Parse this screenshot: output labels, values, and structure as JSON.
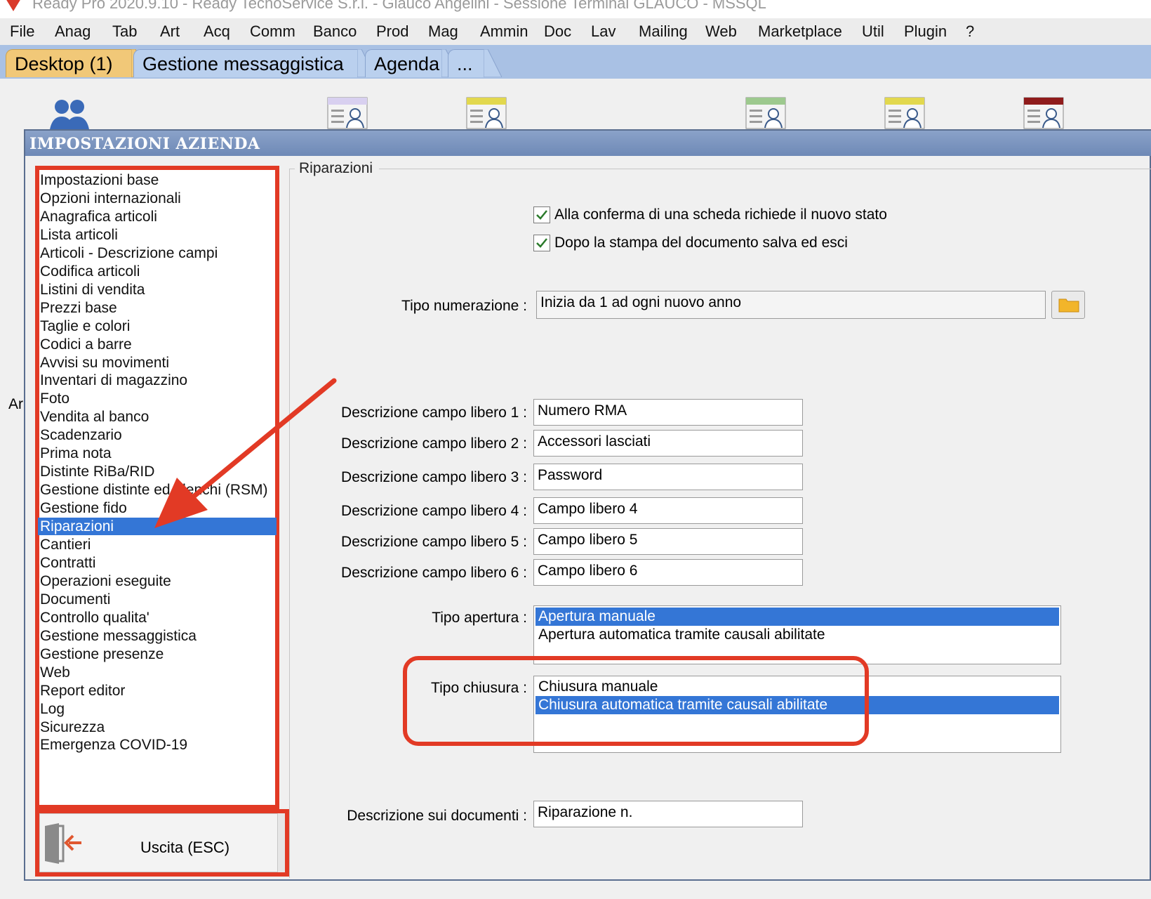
{
  "window": {
    "title": "Ready Pro 2020.9.10 - Ready TecnoService S.r.l. - Glauco Angelini - Sessione Terminal GLAUCO - MSSQL"
  },
  "menu": [
    "File",
    "Anag",
    "Tab",
    "Art",
    "Acq",
    "Comm",
    "Banco",
    "Prod",
    "Mag",
    "Ammin",
    "Doc",
    "Lav",
    "Mailing",
    "Web",
    "Marketplace",
    "Util",
    "Plugin",
    "?"
  ],
  "tabs": [
    {
      "label": "Desktop (1)",
      "active": true
    },
    {
      "label": "Gestione messaggistica",
      "active": false
    },
    {
      "label": "Agenda",
      "active": false
    },
    {
      "label": "...",
      "active": false
    }
  ],
  "desktop": {
    "partial_label": "Ar",
    "icon_colors": [
      "#d8d0f0",
      "#e2d84e",
      "#9dc98e",
      "#e2d84e",
      "#8f1c1c"
    ]
  },
  "dialog": {
    "title": "IMPOSTAZIONI AZIENDA",
    "nav_items": [
      "Impostazioni base",
      "Opzioni internazionali",
      "Anagrafica articoli",
      "Lista articoli",
      "Articoli - Descrizione campi",
      "Codifica articoli",
      "Listini di vendita",
      "Prezzi base",
      "Taglie e colori",
      "Codici a barre",
      "Avvisi su movimenti",
      "Inventari di magazzino",
      "Foto",
      "Vendita al banco",
      "Scadenzario",
      "Prima nota",
      "Distinte RiBa/RID",
      "Gestione distinte ed elenchi (RSM)",
      "Gestione fido",
      "Riparazioni",
      "Cantieri",
      "Contratti",
      "Operazioni eseguite",
      "Documenti",
      "Controllo qualita'",
      "Gestione messaggistica",
      "Gestione presenze",
      "Web",
      "Report editor",
      "Log",
      "Sicurezza",
      "Emergenza COVID-19"
    ],
    "selected_nav": "Riparazioni",
    "exit_label": "Uscita (ESC)",
    "section": {
      "title": "Riparazioni",
      "checkboxes": [
        {
          "label": "Alla conferma di una scheda richiede il nuovo stato",
          "checked": true
        },
        {
          "label": "Dopo la stampa del documento salva ed esci",
          "checked": true
        }
      ],
      "tipo_numerazione": {
        "label": "Tipo numerazione :",
        "value": "Inizia da 1 ad ogni nuovo anno"
      },
      "campi_liberi": [
        {
          "label": "Descrizione campo libero 1 :",
          "value": "Numero RMA"
        },
        {
          "label": "Descrizione campo libero 2 :",
          "value": "Accessori lasciati"
        },
        {
          "label": "Descrizione campo libero 3 :",
          "value": "Password"
        },
        {
          "label": "Descrizione campo libero 4 :",
          "value": "Campo libero 4"
        },
        {
          "label": "Descrizione campo libero 5 :",
          "value": "Campo libero 5"
        },
        {
          "label": "Descrizione campo libero 6 :",
          "value": "Campo libero 6"
        }
      ],
      "tipo_apertura": {
        "label": "Tipo apertura :",
        "options": [
          "Apertura manuale",
          "Apertura automatica tramite causali abilitate"
        ],
        "selected": "Apertura manuale"
      },
      "tipo_chiusura": {
        "label": "Tipo chiusura :",
        "options": [
          "Chiusura manuale",
          "Chiusura automatica tramite causali abilitate"
        ],
        "selected": "Chiusura automatica tramite causali abilitate"
      },
      "descrizione_documenti": {
        "label": "Descrizione sui documenti :",
        "value": "Riparazione n."
      }
    }
  },
  "annotation_color": "#e23a25"
}
